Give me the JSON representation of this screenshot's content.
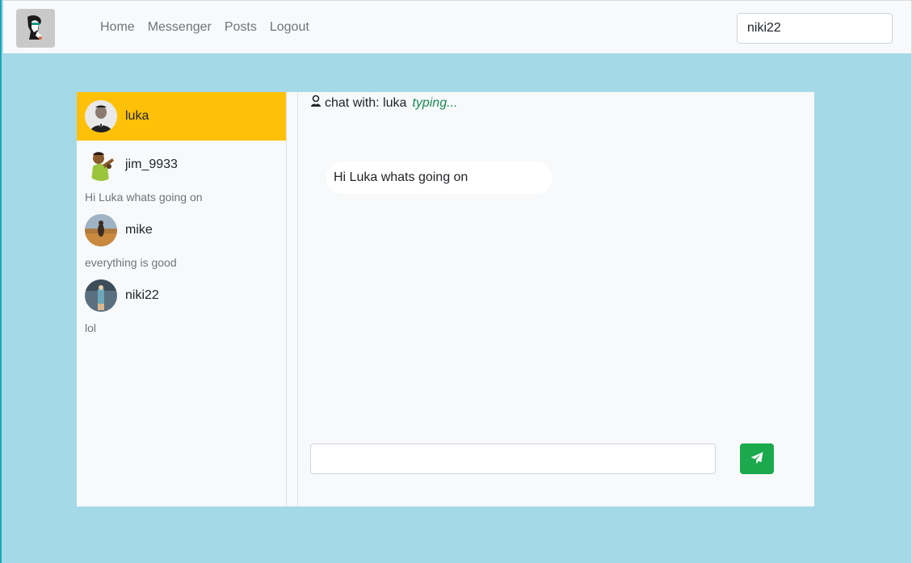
{
  "navbar": {
    "links": [
      "Home",
      "Messenger",
      "Posts",
      "Logout"
    ],
    "current_user": "niki22"
  },
  "contacts": [
    {
      "name": "luka",
      "preview": "",
      "active": true
    },
    {
      "name": "jim_9933",
      "preview": "Hi Luka whats going on",
      "active": false
    },
    {
      "name": "mike",
      "preview": "everything is good",
      "active": false
    },
    {
      "name": "niki22",
      "preview": "lol",
      "active": false
    }
  ],
  "chat": {
    "header_prefix": "chat with: luka",
    "typing_indicator": "typing...",
    "messages": [
      "Hi Luka whats going on"
    ],
    "input_value": ""
  },
  "colors": {
    "page_bg": "#a6d9e7",
    "active_contact": "#ffc107",
    "send_button": "#1aa94c",
    "typing": "#198754"
  }
}
